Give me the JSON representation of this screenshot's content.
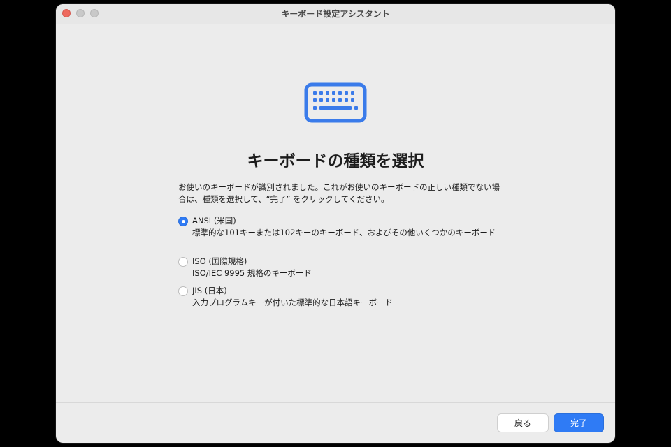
{
  "window": {
    "title": "キーボード設定アシスタント"
  },
  "icon": {
    "name": "keyboard-icon",
    "color": "#3a7bea"
  },
  "main": {
    "heading": "キーボードの種類を選択",
    "description": "お使いのキーボードが識別されました。これがお使いのキーボードの正しい種類でない場合は、種類を選択して、“完了” をクリックしてください。",
    "options": [
      {
        "title": "ANSI (米国)",
        "description": "標準的な101キーまたは102キーのキーボード、およびその他いくつかのキーボード",
        "selected": true
      },
      {
        "title": "ISO (国際規格)",
        "description": "ISO/IEC 9995 規格のキーボード",
        "selected": false
      },
      {
        "title": "JIS (日本)",
        "description": "入力プログラムキーが付いた標準的な日本語キーボード",
        "selected": false
      }
    ]
  },
  "footer": {
    "back_label": "戻る",
    "done_label": "完了"
  },
  "colors": {
    "accent": "#2f7bf5",
    "close": "#ee6a5f"
  }
}
